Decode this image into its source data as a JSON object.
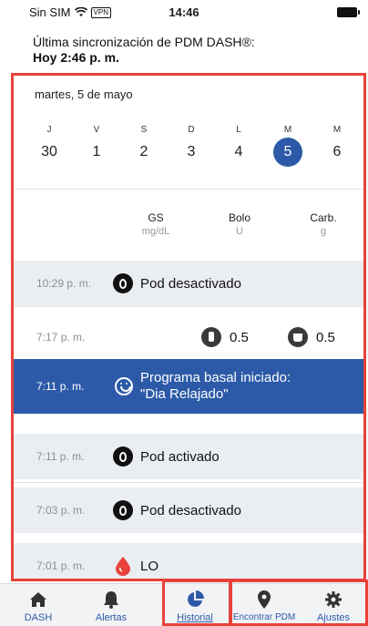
{
  "status_bar": {
    "carrier": "Sin SIM",
    "vpn": "VPN",
    "time": "14:46"
  },
  "sync": {
    "line1": "Última sincronización de PDM DASH®:",
    "line2": "Hoy 2:46 p. m."
  },
  "date_label": "martes, 5 de mayo",
  "week": [
    {
      "dow": "J",
      "num": "30"
    },
    {
      "dow": "V",
      "num": "1"
    },
    {
      "dow": "S",
      "num": "2"
    },
    {
      "dow": "D",
      "num": "3"
    },
    {
      "dow": "L",
      "num": "4"
    },
    {
      "dow": "M",
      "num": "5",
      "selected": true
    },
    {
      "dow": "M",
      "num": "6"
    }
  ],
  "columns": {
    "gs": {
      "title": "GS",
      "unit": "mg/dL"
    },
    "bolo": {
      "title": "Bolo",
      "unit": "U"
    },
    "carb": {
      "title": "Carb.",
      "unit": "g"
    }
  },
  "events": [
    {
      "time": "10:29 p. m.",
      "text": "Pod desactivado",
      "icon": "pod-icon"
    },
    {
      "time": "7:17 p. m.",
      "bolus": "0.5",
      "carbs": "0.5"
    },
    {
      "time": "7:11 p. m.",
      "text_line1": "Programa basal iniciado:",
      "text_line2": "\"Dia Relajado\"",
      "icon": "smiley-icon"
    },
    {
      "time": "7:11 p. m.",
      "text": "Pod activado",
      "icon": "pod-icon"
    },
    {
      "time": "7:03 p. m.",
      "text": "Pod desactivado",
      "icon": "pod-icon"
    },
    {
      "time": "7:01 p. m.",
      "text": "LO",
      "icon": "blood-drop-icon"
    }
  ],
  "tabs": [
    {
      "label": "DASH",
      "icon": "home-icon"
    },
    {
      "label": "Alertas",
      "icon": "bell-icon"
    },
    {
      "label": "Historial",
      "icon": "pie-chart-icon",
      "active": true
    },
    {
      "label": "Encontrar PDM",
      "icon": "location-pin-icon"
    },
    {
      "label": "Ajustes",
      "icon": "gear-icon"
    }
  ],
  "colors": {
    "accent": "#2d5aa8",
    "highlight_frame": "#e8423a",
    "alt_row": "#eaedf2",
    "drop": "#e8423a"
  }
}
